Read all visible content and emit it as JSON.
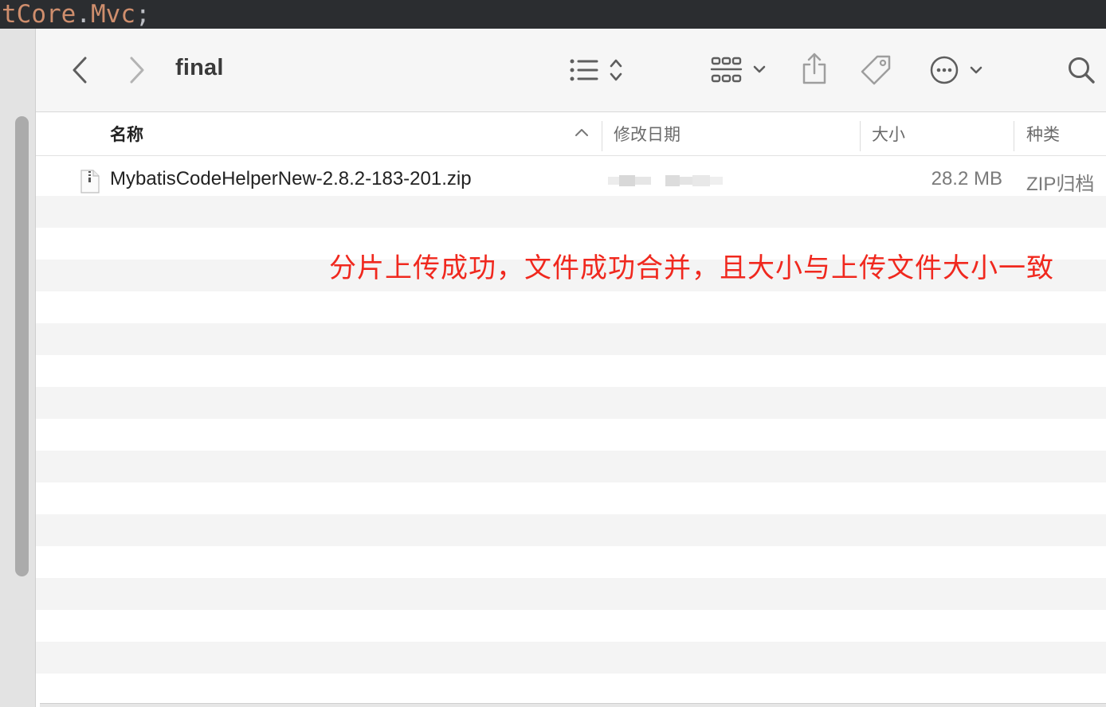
{
  "editor": {
    "code_prefix": "tCore",
    "code_dot": ".",
    "code_member": "Mvc",
    "code_semi": ";"
  },
  "finder": {
    "folder_title": "final",
    "icons": {
      "back": "chevron-left-icon",
      "forward": "chevron-right-icon",
      "view": "list-view-icon",
      "group": "grid-group-icon",
      "share": "share-icon",
      "tag": "tag-icon",
      "more": "ellipsis-circle-icon",
      "search": "search-icon"
    },
    "columns": {
      "name": "名称",
      "modified": "修改日期",
      "size": "大小",
      "kind": "种类"
    },
    "files": [
      {
        "name": "MybatisCodeHelperNew-2.8.2-183-201.zip",
        "modified": "",
        "size": "28.2 MB",
        "kind": "ZIP归档"
      }
    ]
  },
  "annotation": {
    "text": "分片上传成功，文件成功合并，且大小与上传文件大小一致",
    "color": "#f0281e"
  }
}
